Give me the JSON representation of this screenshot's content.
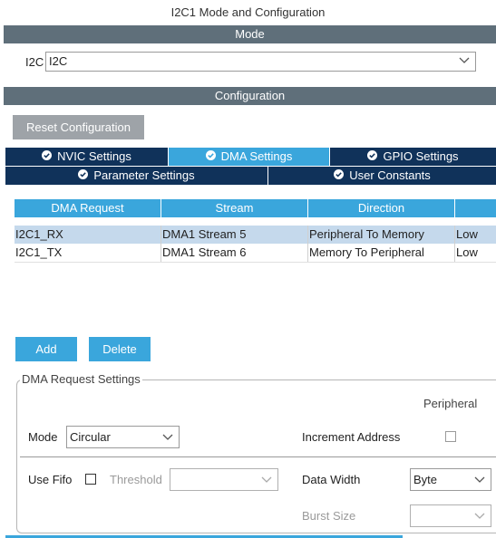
{
  "window_title": "I2C1 Mode and Configuration",
  "mode_section": {
    "title": "Mode",
    "label": "I2C",
    "value": "I2C"
  },
  "config_section": {
    "title": "Configuration",
    "reset_button": "Reset Configuration",
    "tabs": [
      {
        "label": "NVIC Settings",
        "active": false
      },
      {
        "label": "DMA Settings",
        "active": true
      },
      {
        "label": "GPIO Settings",
        "active": false
      },
      {
        "label": "Parameter Settings",
        "active": false
      },
      {
        "label": "User Constants",
        "active": false
      }
    ]
  },
  "dma_table": {
    "columns": [
      "DMA Request",
      "Stream",
      "Direction",
      ""
    ],
    "rows": [
      {
        "request": "I2C1_RX",
        "stream": "DMA1 Stream 5",
        "direction": "Peripheral To Memory",
        "priority": "Low",
        "selected": true
      },
      {
        "request": "I2C1_TX",
        "stream": "DMA1 Stream 6",
        "direction": "Memory To Peripheral",
        "priority": "Low",
        "selected": false
      }
    ]
  },
  "actions": {
    "add": "Add",
    "delete": "Delete"
  },
  "request_settings": {
    "legend": "DMA Request Settings",
    "peripheral_header": "Peripheral",
    "mode_label": "Mode",
    "mode_value": "Circular",
    "increment_label": "Increment Address",
    "use_fifo_label": "Use Fifo",
    "threshold_label": "Threshold",
    "threshold_value": "",
    "data_width_label": "Data Width",
    "data_width_value": "Byte",
    "burst_size_label": "Burst Size",
    "burst_size_value": ""
  },
  "colors": {
    "accent": "#3aa6dc",
    "tab_dark": "#10325a",
    "header_bar": "#5f6f7a",
    "selected_row": "#c5d9ec"
  },
  "icons": {
    "tab_check": "check-circle-icon",
    "dropdown": "chevron-down-icon"
  }
}
